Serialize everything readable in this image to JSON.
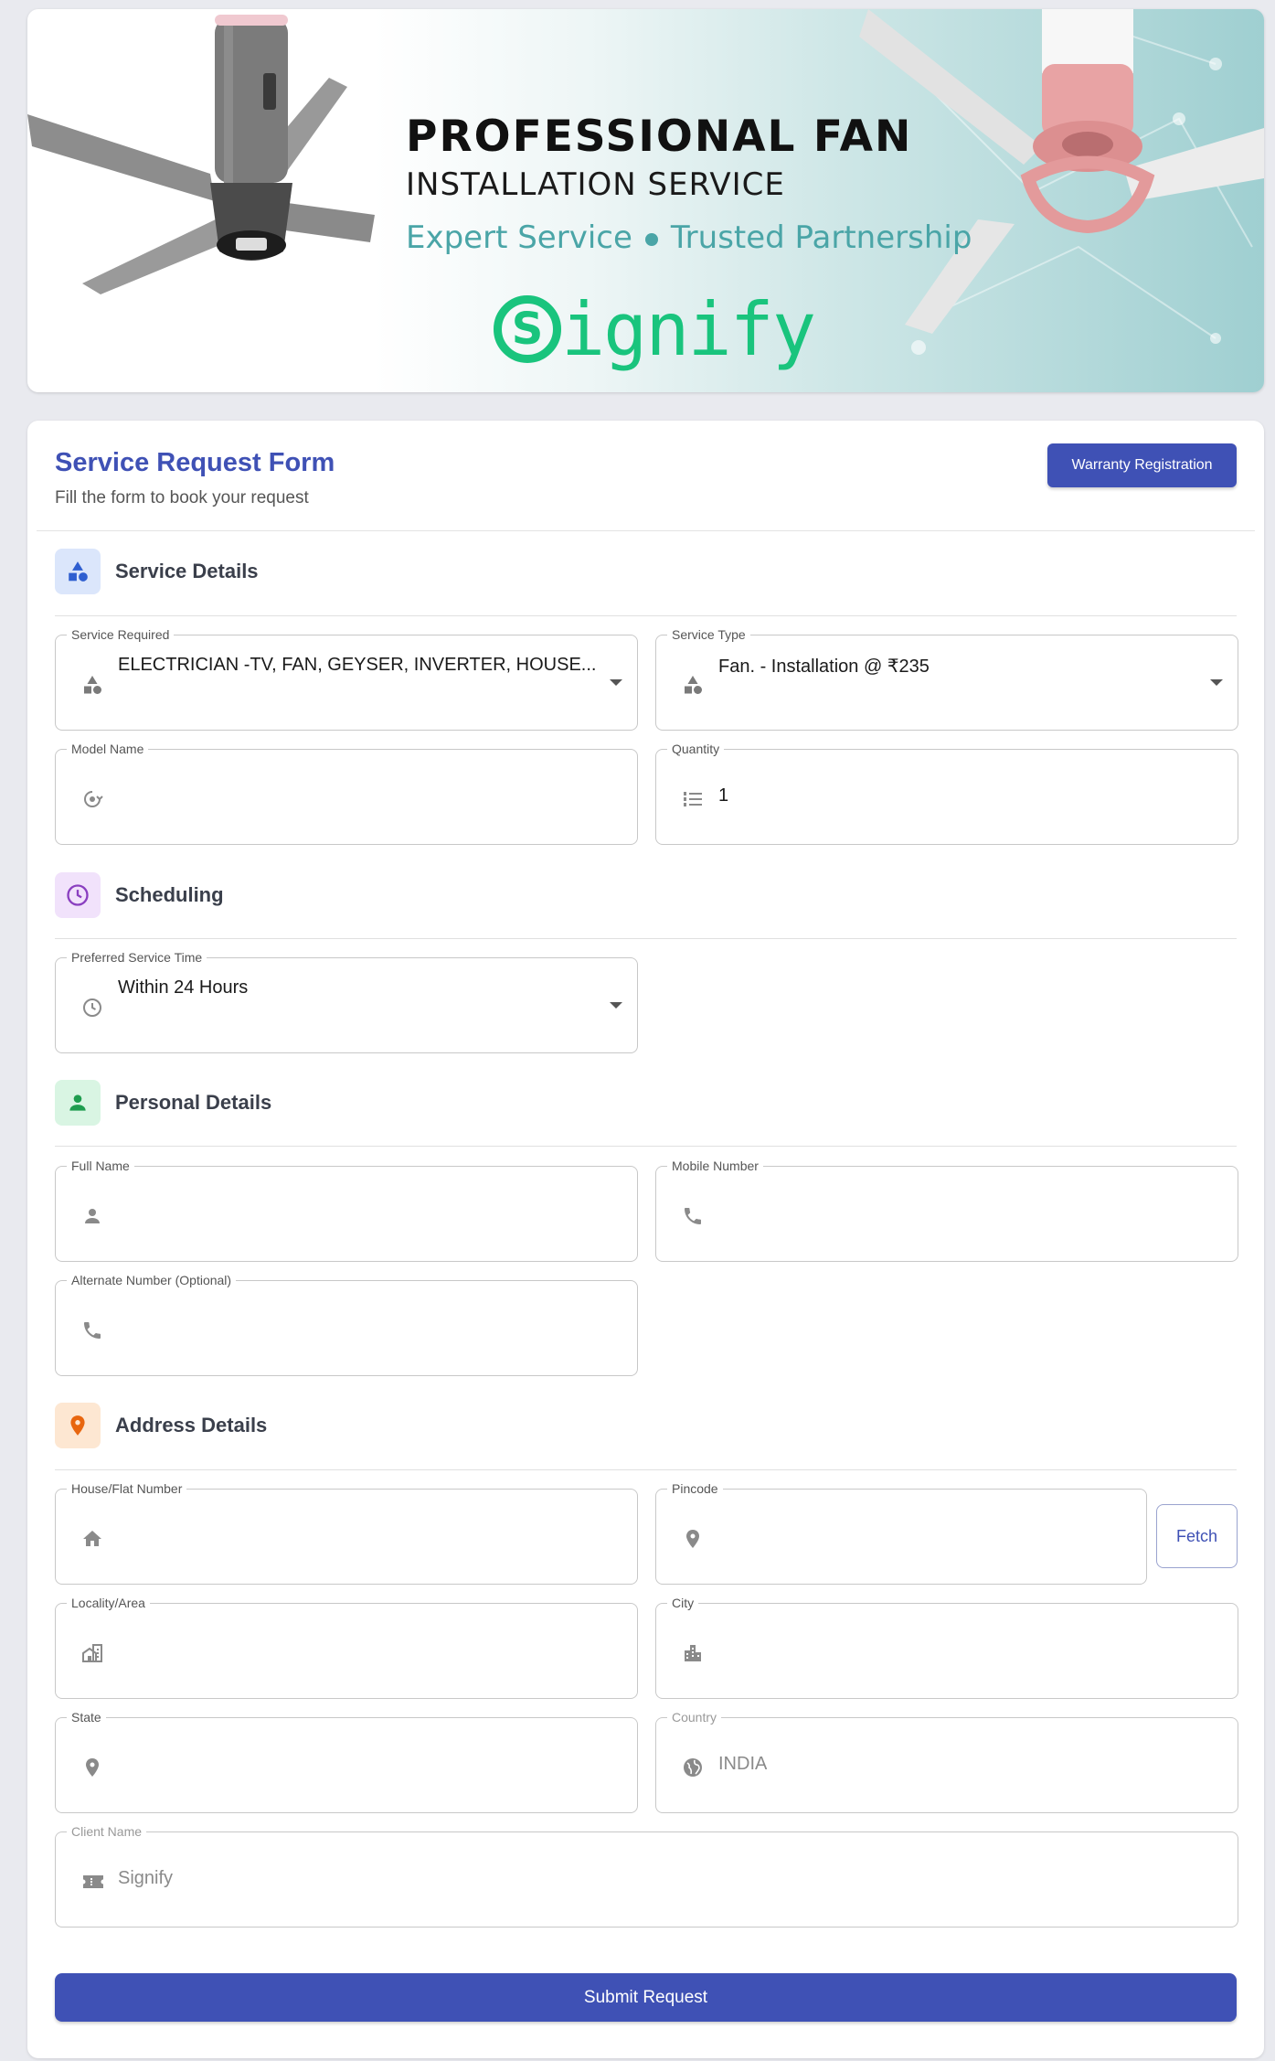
{
  "banner": {
    "title": "PROFESSIONAL FAN",
    "subtitle": "INSTALLATION SERVICE",
    "tagline_left": "Expert Service",
    "tagline_right": "Trusted Partnership",
    "logo_mark": "S",
    "logo_word": "ignify",
    "brand_color": "#19c47d"
  },
  "form": {
    "title": "Service Request Form",
    "subtitle": "Fill the form to book your request",
    "warranty_button": "Warranty Registration",
    "accent": "#3f51b5"
  },
  "sections": {
    "service": {
      "title": "Service Details",
      "icon": "category-icon",
      "icon_bg": "#dbe6fb",
      "icon_color": "#2f5fd0"
    },
    "scheduling": {
      "title": "Scheduling",
      "icon": "clock-icon",
      "icon_bg": "#f1e2fb",
      "icon_color": "#8a3fc0"
    },
    "personal": {
      "title": "Personal Details",
      "icon": "person-icon",
      "icon_bg": "#d9f5e3",
      "icon_color": "#1f9d4f"
    },
    "address": {
      "title": "Address Details",
      "icon": "location-pin-icon",
      "icon_bg": "#fde7d2",
      "icon_color": "#e8660f"
    }
  },
  "fields": {
    "service_required": {
      "label": "Service Required",
      "value": "ELECTRICIAN -TV, FAN, GEYSER, INVERTER, HOUSE...",
      "icon": "category-icon"
    },
    "service_type": {
      "label": "Service Type",
      "value": "Fan. - Installation @ ₹235",
      "icon": "category-icon"
    },
    "model_name": {
      "label": "Model Name",
      "value": "",
      "icon": "model-icon"
    },
    "quantity": {
      "label": "Quantity",
      "value": "1",
      "icon": "list-numbered-icon"
    },
    "service_time": {
      "label": "Preferred Service Time",
      "value": "Within 24 Hours",
      "icon": "clock-icon"
    },
    "full_name": {
      "label": "Full Name",
      "value": "",
      "icon": "person-icon"
    },
    "mobile": {
      "label": "Mobile Number",
      "value": "",
      "icon": "phone-icon"
    },
    "alternate": {
      "label": "Alternate Number (Optional)",
      "value": "",
      "icon": "phone-icon"
    },
    "house": {
      "label": "House/Flat Number",
      "value": "",
      "icon": "home-icon"
    },
    "pincode": {
      "label": "Pincode",
      "value": "",
      "icon": "location-pin-icon"
    },
    "locality": {
      "label": "Locality/Area",
      "value": "",
      "icon": "locality-icon"
    },
    "city": {
      "label": "City",
      "value": "",
      "icon": "city-icon"
    },
    "state": {
      "label": "State",
      "value": "",
      "icon": "location-pin-icon"
    },
    "country": {
      "label": "Country",
      "value": "INDIA",
      "icon": "globe-icon"
    },
    "client": {
      "label": "Client Name",
      "value": "Signify",
      "icon": "ticket-icon"
    }
  },
  "buttons": {
    "fetch": "Fetch",
    "submit": "Submit Request"
  }
}
